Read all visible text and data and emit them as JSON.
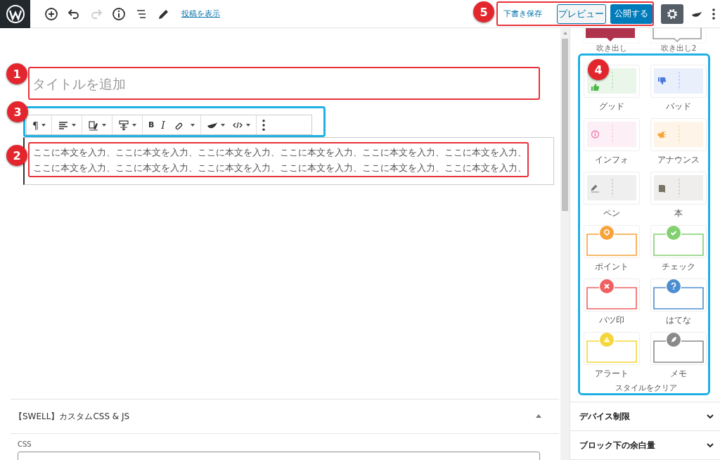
{
  "header": {
    "tools": [
      {
        "kind": "add",
        "disabled": false
      },
      {
        "kind": "undo",
        "disabled": false
      },
      {
        "kind": "redo",
        "disabled": true
      },
      {
        "kind": "info",
        "disabled": false
      },
      {
        "kind": "outline",
        "disabled": false
      },
      {
        "kind": "edit",
        "disabled": false
      }
    ],
    "view_link": "投稿を表示",
    "callout": {
      "number": "5",
      "color": "#e8323a"
    },
    "save_draft": "下書き保存",
    "preview": "プレビュー",
    "publish": "公開する",
    "settings_selected": true
  },
  "editor": {
    "title_callout": {
      "number": "1",
      "color": "#e8323a"
    },
    "title_placeholder": "タイトルを追加",
    "toolbar_callout": {
      "number": "3",
      "color": "#1fb0e6"
    },
    "block_toolbar": [
      {
        "items": [
          {
            "kind": "text",
            "label": "¶",
            "dropdown": true
          }
        ]
      },
      {
        "items": [
          {
            "kind": "align",
            "dropdown": true
          }
        ]
      },
      {
        "items": [
          {
            "kind": "highlight",
            "dropdown": true
          }
        ]
      },
      {
        "items": [
          {
            "kind": "spacing",
            "dropdown": true
          }
        ]
      },
      {
        "items": [
          {
            "kind": "text",
            "label": "B",
            "dropdown": false
          },
          {
            "kind": "italic",
            "label": "I",
            "dropdown": false
          },
          {
            "kind": "link",
            "dropdown": false
          },
          {
            "kind": "more",
            "dropdown": true
          }
        ]
      },
      {
        "items": [
          {
            "kind": "swell",
            "dropdown": true
          },
          {
            "kind": "code",
            "dropdown": true
          }
        ]
      },
      {
        "items": [
          {
            "kind": "options",
            "dropdown": false
          }
        ]
      }
    ],
    "paragraph_callout": {
      "number": "2",
      "color": "#e8323a"
    },
    "paragraph_lines": [
      "ここに本文を入力、ここに本文を入力、ここに本文を入力、ここに本文を入力、ここに本文を入力、ここに本文を入力、",
      "ここに本文を入力、ここに本文を入力、ここに本文を入力、ここに本文を入力、ここに本文を入力、ここに本文を入力、"
    ],
    "meta_box": {
      "title": "【SWELL】カスタムCSS & JS",
      "expanded": true,
      "field_label": "CSS"
    }
  },
  "sidebar": {
    "partial_styles": [
      {
        "label": "吹き出し",
        "kind": "filled",
        "color": "#b0334e"
      },
      {
        "label": "吹き出し2",
        "kind": "outlined",
        "color": "#999999"
      }
    ],
    "styles_callout": {
      "number": "4",
      "color": "#1fb0e6"
    },
    "styles": [
      {
        "label": "グッド",
        "kind": "tinted",
        "color": "#4cb84a"
      },
      {
        "label": "バッド",
        "kind": "tinted",
        "color": "#4a78dc"
      },
      {
        "label": "インフォ",
        "kind": "tinted",
        "color": "#f07ab0"
      },
      {
        "label": "アナウンス",
        "kind": "tinted",
        "color": "#f5a43a"
      },
      {
        "label": "ペン",
        "kind": "tinted",
        "color": "#777777"
      },
      {
        "label": "本",
        "kind": "tinted",
        "color": "#7a7466"
      },
      {
        "label": "ポイント",
        "kind": "framed",
        "color": "#f9a23a"
      },
      {
        "label": "チェック",
        "kind": "framed",
        "color": "#82d06f"
      },
      {
        "label": "バツ印",
        "kind": "framed",
        "color": "#ef6161"
      },
      {
        "label": "はてな",
        "kind": "framed",
        "color": "#4d8ed0"
      },
      {
        "label": "アラート",
        "kind": "framed",
        "color": "#f5d63a"
      },
      {
        "label": "メモ",
        "kind": "framed",
        "color": "#8a8a8a"
      }
    ],
    "clear_styles": "スタイルをクリア",
    "sections": [
      {
        "title": "デバイス制限",
        "expanded": false
      },
      {
        "title": "ブロック下の余白量",
        "expanded": false
      }
    ]
  }
}
